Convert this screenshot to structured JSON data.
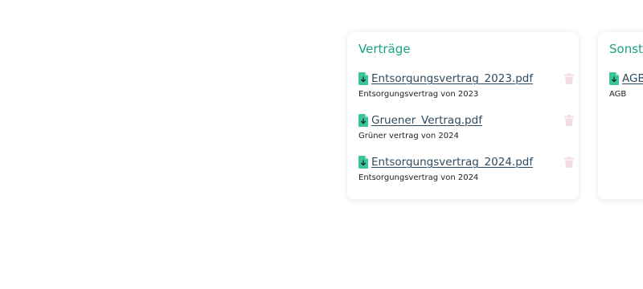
{
  "cards": [
    {
      "title": "Verträge",
      "documents": [
        {
          "filename": "Entsorgungsvertrag_2023.pdf",
          "description": "Entsorgungsvertrag von 2023",
          "icon": "file-download-icon",
          "delete_icon": "trash-icon"
        },
        {
          "filename": "Gruener_Vertrag.pdf",
          "description": "Grüner vertrag von 2024",
          "icon": "file-download-icon",
          "delete_icon": "trash-icon"
        },
        {
          "filename": "Entsorgungsvertrag_2024.pdf",
          "description": "Entsorgungsvertrag von 2024",
          "icon": "file-download-icon",
          "delete_icon": "trash-icon"
        }
      ]
    },
    {
      "title": "Sonsti",
      "documents": [
        {
          "filename": "AGB",
          "description": "AGB",
          "icon": "file-download-icon"
        }
      ]
    }
  ],
  "colors": {
    "title_accent": "#1aa37e",
    "file_icon": "#3cc49a",
    "link_text": "#2f4a5f",
    "trash_icon": "#f3dde2"
  }
}
